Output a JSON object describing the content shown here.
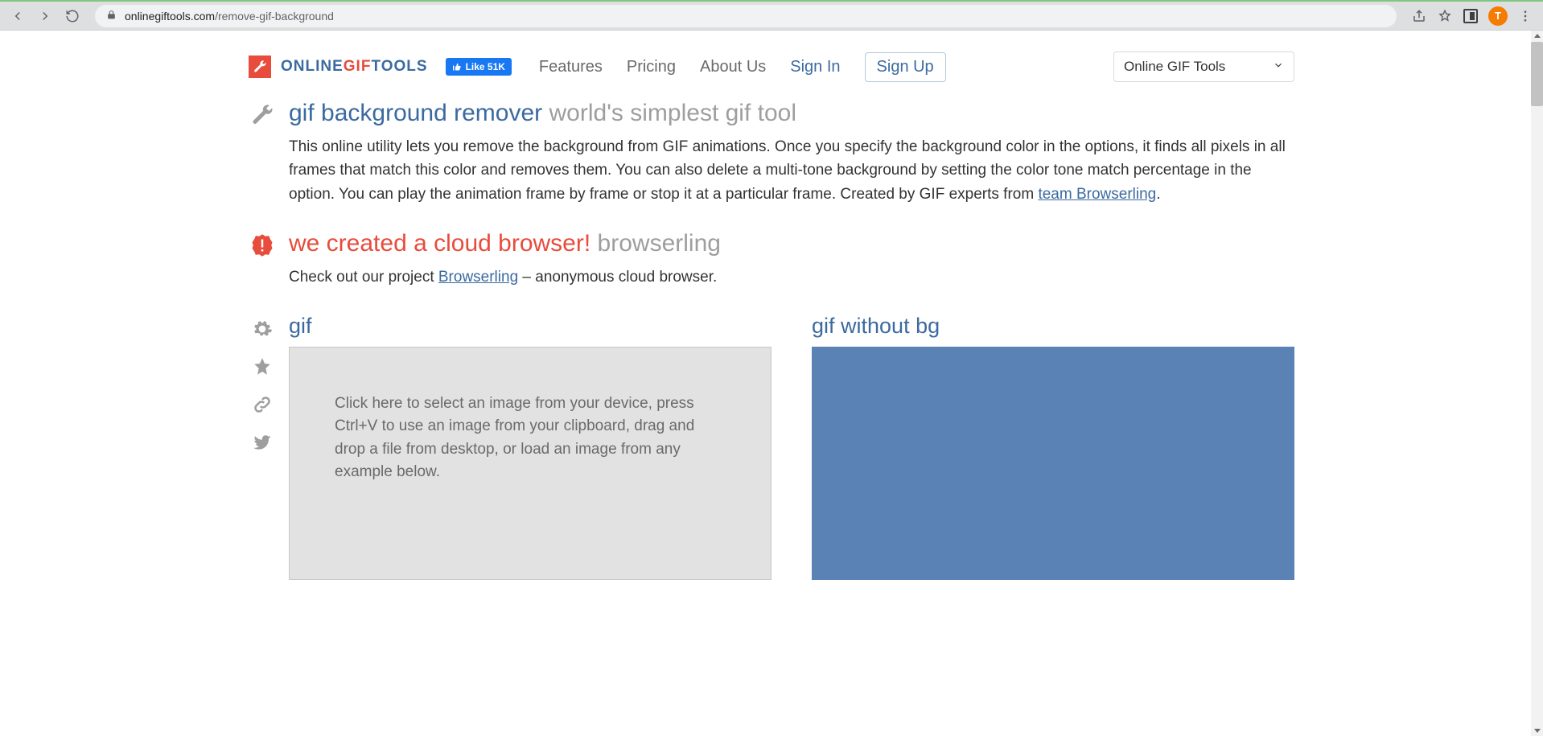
{
  "browser": {
    "url_host": "onlinegiftools.com",
    "url_path": "/remove-gif-background",
    "avatar_letter": "T"
  },
  "header": {
    "logo": {
      "pre": "ONLINE",
      "mid": "GIF",
      "post": "TOOLS"
    },
    "fb_like": "Like 51K",
    "nav": {
      "features": "Features",
      "pricing": "Pricing",
      "about": "About Us",
      "signin": "Sign In",
      "signup": "Sign Up"
    },
    "selector_label": "Online GIF Tools"
  },
  "intro": {
    "title_main": "gif background remover",
    "title_sub": "world's simplest gif tool",
    "paragraph_pre": "This online utility lets you remove the background from GIF animations. Once you specify the background color in the options, it finds all pixels in all frames that match this color and removes them. You can also delete a multi-tone background by setting the color tone match percentage in the option. You can play the animation frame by frame or stop it at a particular frame. Created by GIF experts from ",
    "paragraph_link": "team Browserling",
    "paragraph_post": "."
  },
  "promo": {
    "title_main": "we created a cloud browser!",
    "title_sub": "browserling",
    "text_pre": "Check out our project ",
    "text_link": "Browserling",
    "text_post": " – anonymous cloud browser."
  },
  "io": {
    "left_title": "gif",
    "drop_text": "Click here to select an image from your device, press Ctrl+V to use an image from your clipboard, drag and drop a file from desktop, or load an image from any example below.",
    "right_title": "gif without bg"
  }
}
